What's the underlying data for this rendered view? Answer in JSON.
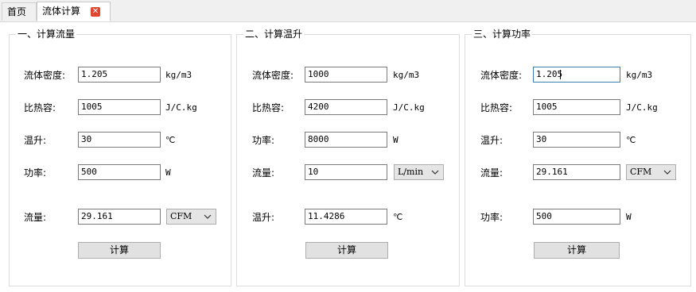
{
  "tabs": {
    "home": "首页",
    "active": "流体计算"
  },
  "panel1": {
    "title": "一、计算流量",
    "rows": [
      {
        "label": "流体密度:",
        "value": "1.205",
        "unit": "kg/m3"
      },
      {
        "label": "比热容:",
        "value": "1005",
        "unit": "J/C.kg"
      },
      {
        "label": "温升:",
        "value": "30",
        "unit": "℃"
      },
      {
        "label": "功率:",
        "value": "500",
        "unit": "W"
      }
    ],
    "result": {
      "label": "流量:",
      "value": "29.161",
      "select": "CFM"
    },
    "button": "计算"
  },
  "panel2": {
    "title": "二、计算温升",
    "rows": [
      {
        "label": "流体密度:",
        "value": "1000",
        "unit": "kg/m3"
      },
      {
        "label": "比热容:",
        "value": "4200",
        "unit": "J/C.kg"
      },
      {
        "label": "功率:",
        "value": "8000",
        "unit": "W"
      },
      {
        "label": "流量:",
        "value": "10",
        "select": "L/min"
      }
    ],
    "result": {
      "label": "温升:",
      "value": "11.4286",
      "unit": "℃"
    },
    "button": "计算"
  },
  "panel3": {
    "title": "三、计算功率",
    "rows": [
      {
        "label": "流体密度:",
        "value": "1.205",
        "unit": "kg/m3"
      },
      {
        "label": "比热容:",
        "value": "1005",
        "unit": "J/C.kg"
      },
      {
        "label": "温升:",
        "value": "30",
        "unit": "℃"
      },
      {
        "label": "流量:",
        "value": "29.161",
        "select": "CFM"
      }
    ],
    "result": {
      "label": "功率:",
      "value": "500",
      "unit": "W"
    },
    "button": "计算"
  },
  "colors": {
    "tab_close": "#e0462f",
    "focus_border": "#3c7fb1",
    "group_border": "#dcdcdc"
  },
  "icons": {
    "tab_close": "close-icon",
    "dropdown": "chevron-down-icon"
  }
}
